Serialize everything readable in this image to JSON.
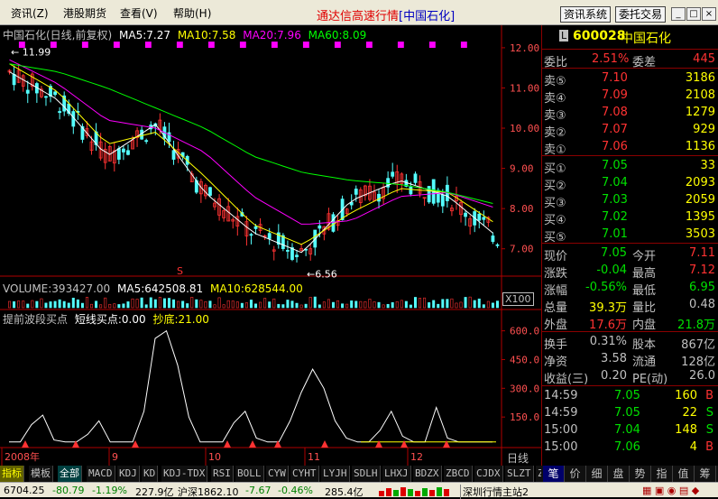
{
  "menu": [
    "资讯(Z)",
    "港股期货",
    "查看(V)",
    "帮助(H)"
  ],
  "app_title": "通达信高速行情",
  "app_title_stock": "[中国石化]",
  "toolbar": {
    "btn1": "资讯系统",
    "btn2": "委托交易"
  },
  "window_controls": {
    "min": "_",
    "max": "□",
    "close": "×"
  },
  "chart": {
    "header_name": "中国石化(日线,前复权)",
    "ma5": "MA5:7.27",
    "ma10": "MA10:7.58",
    "ma20": "MA20:7.96",
    "ma60": "MA60:8.09",
    "y_ticks": [
      "12.00",
      "11.00",
      "10.00",
      "9.00",
      "8.00",
      "7.00"
    ],
    "high_label": "11.99",
    "low_label": "6.56",
    "volume_header": "VOLUME:393427.00",
    "vol_ma5": "MA5:642508.81",
    "vol_ma10": "MA10:628544.00",
    "vol_scale": "X100",
    "ind_header": "提前波段买点",
    "ind_short": "短线买点:0.00",
    "ind_bottom": "抄底:21.00",
    "ind_ticks": [
      "600.0",
      "450.0",
      "300.0",
      "150.0"
    ],
    "x_labels": [
      "2008年",
      "9",
      "10",
      "11",
      "12"
    ],
    "period_label": "日线",
    "signal_mark": "S",
    "colors": {
      "up": "#ff3232",
      "down": "#54ffff",
      "ma5": "#ffffff",
      "ma10": "#ffff00",
      "ma20": "#ff00ff",
      "ma60": "#00ff00",
      "axis": "#b00000",
      "tick": "#ff5050"
    }
  },
  "chart_data": {
    "type": "line",
    "title": "中国石化(日线,前复权)",
    "xlabel": "",
    "ylabel": "",
    "x": [
      "2008-08",
      "2008-09",
      "2008-10",
      "2008-11",
      "2008-12"
    ],
    "ylim": [
      6.5,
      12.2
    ],
    "series": [
      {
        "name": "MA5",
        "values": [
          11.4,
          10.7,
          9.3,
          10.1,
          8.4,
          7.4,
          6.9,
          8.2,
          8.7,
          8.3,
          7.3
        ]
      },
      {
        "name": "MA10",
        "values": [
          11.6,
          10.9,
          9.6,
          9.9,
          8.8,
          7.6,
          7.1,
          7.9,
          8.5,
          8.4,
          7.6
        ]
      },
      {
        "name": "MA20",
        "values": [
          11.7,
          11.1,
          10.2,
          10.0,
          9.4,
          8.3,
          7.6,
          7.7,
          8.3,
          8.4,
          8.0
        ]
      },
      {
        "name": "MA60",
        "values": [
          11.6,
          11.4,
          11.0,
          10.5,
          10.0,
          9.3,
          8.9,
          8.7,
          8.6,
          8.4,
          8.1
        ]
      }
    ],
    "indicator": {
      "name": "提前波段买点",
      "ylim": [
        0,
        650
      ],
      "ticks": [
        150,
        300,
        450,
        600
      ]
    }
  },
  "quote": {
    "code": "600028",
    "name": "中国石化",
    "wei_bi_label": "委比",
    "wei_bi": "2.51%",
    "wei_cha_label": "委差",
    "wei_cha": "445",
    "asks": [
      {
        "label": "卖⑤",
        "price": "7.10",
        "vol": "3186"
      },
      {
        "label": "卖④",
        "price": "7.09",
        "vol": "2108"
      },
      {
        "label": "卖③",
        "price": "7.08",
        "vol": "1279"
      },
      {
        "label": "卖②",
        "price": "7.07",
        "vol": "929"
      },
      {
        "label": "卖①",
        "price": "7.06",
        "vol": "1136"
      }
    ],
    "bids": [
      {
        "label": "买①",
        "price": "7.05",
        "vol": "33"
      },
      {
        "label": "买②",
        "price": "7.04",
        "vol": "2093"
      },
      {
        "label": "买③",
        "price": "7.03",
        "vol": "2059"
      },
      {
        "label": "买④",
        "price": "7.02",
        "vol": "1395"
      },
      {
        "label": "买⑤",
        "price": "7.01",
        "vol": "3503"
      }
    ],
    "stats": [
      {
        "l1": "现价",
        "v1": "7.05",
        "l2": "今开",
        "v2": "7.11"
      },
      {
        "l1": "涨跌",
        "v1": "-0.04",
        "l2": "最高",
        "v2": "7.12"
      },
      {
        "l1": "涨幅",
        "v1": "-0.56%",
        "l2": "最低",
        "v2": "6.95"
      },
      {
        "l1": "总量",
        "v1": "39.3万",
        "l2": "量比",
        "v2": "0.48"
      },
      {
        "l1": "外盘",
        "v1": "17.6万",
        "l2": "内盘",
        "v2": "21.8万"
      }
    ],
    "stats2": [
      {
        "l1": "换手",
        "v1": "0.31%",
        "l2": "股本",
        "v2": "867亿"
      },
      {
        "l1": "净资",
        "v1": "3.58",
        "l2": "流通",
        "v2": "128亿"
      },
      {
        "l1": "收益(三)",
        "v1": "0.20",
        "l2": "PE(动)",
        "v2": "26.0"
      }
    ],
    "ticks": [
      {
        "time": "14:59",
        "price": "7.05",
        "vol": "160",
        "dir": "B"
      },
      {
        "time": "14:59",
        "price": "7.05",
        "vol": "22",
        "dir": "S"
      },
      {
        "time": "15:00",
        "price": "7.04",
        "vol": "148",
        "dir": "S"
      },
      {
        "time": "15:00",
        "price": "7.06",
        "vol": "4",
        "dir": "B"
      }
    ]
  },
  "bottom_tabs": [
    "指标",
    "模板",
    "全部",
    "MACD",
    "KDJ",
    "KD",
    "KDJ-TDX",
    "RSI",
    "BOLL",
    "CYW",
    "CYHT",
    "LYJH",
    "SDLH",
    "LHXJ",
    "BDZX",
    "ZBCD",
    "CJDX",
    "SLZT",
    "ZLMM"
  ],
  "right_tabs": [
    "笔",
    "价",
    "细",
    "盘",
    "势",
    "指",
    "值",
    "筹"
  ],
  "status": {
    "sh_index": "6704.25",
    "sh_chg": "-80.79",
    "sh_pct": "-1.19%",
    "sh_amt": "227.9亿",
    "sz_label": "沪深1862.10",
    "sz_chg": "-7.67",
    "sz_pct": "-0.46%",
    "sz_amt": "285.4亿",
    "server": "深圳行情主站2"
  }
}
